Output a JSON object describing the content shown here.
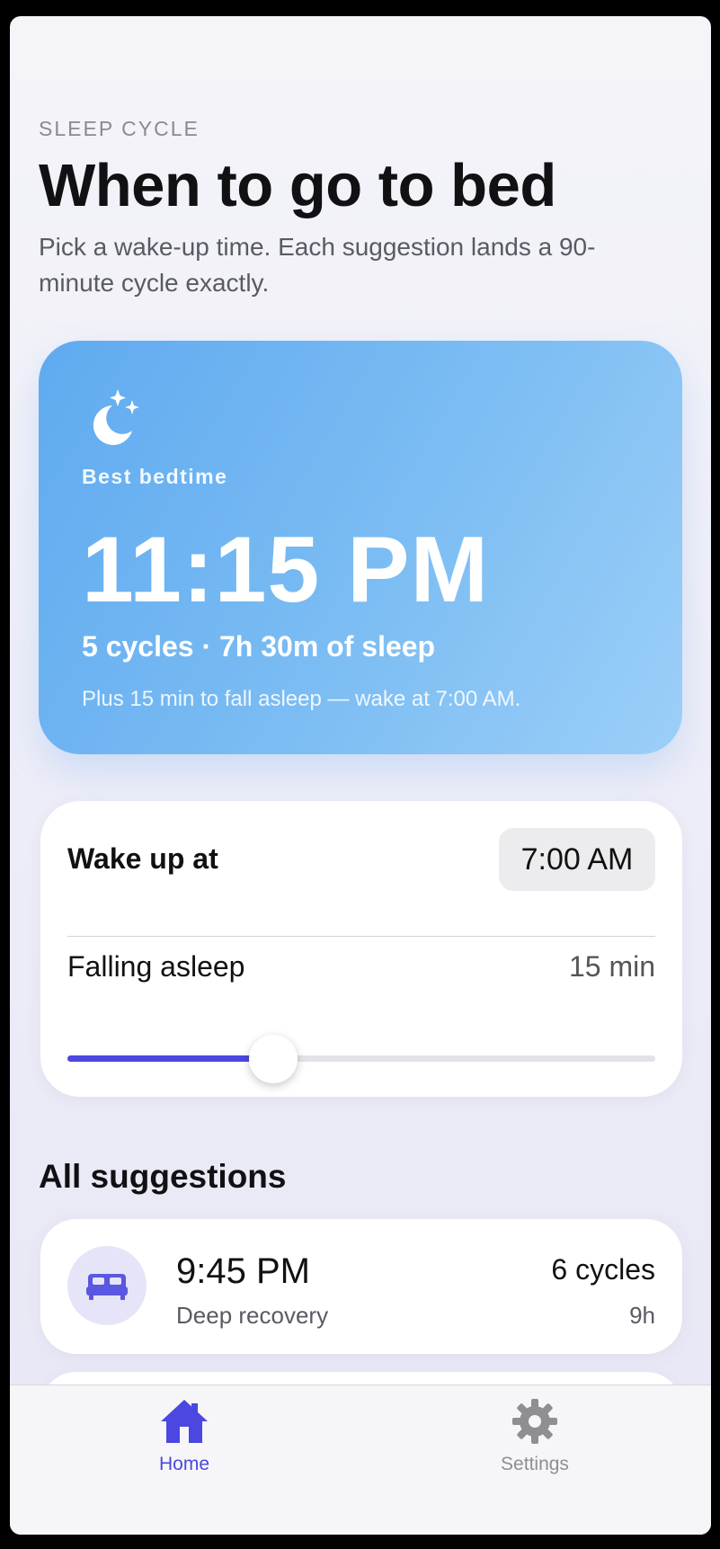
{
  "header": {
    "eyebrow": "SLEEP CYCLE",
    "title": "When to go to bed",
    "subtitle": "Pick a wake-up time. Each suggestion lands a 90-minute cycle exactly."
  },
  "hero": {
    "icon": "moon-stars-icon",
    "label": "Best bedtime",
    "time": "11:15 PM",
    "summary": "5 cycles · 7h 30m of sleep",
    "note": "Plus 15 min to fall asleep — wake at 7:00 AM."
  },
  "settings": {
    "wake_label": "Wake up at",
    "wake_time": "7:00 AM",
    "asleep_label": "Falling asleep",
    "asleep_value": "15 min",
    "slider_fraction": 0.35
  },
  "suggestions": {
    "title": "All suggestions",
    "items": [
      {
        "time": "9:45 PM",
        "description": "Deep recovery",
        "cycles": "6 cycles",
        "hours": "9h",
        "icon": "bed-icon"
      }
    ]
  },
  "tabbar": {
    "home": {
      "label": "Home",
      "icon": "home-icon"
    },
    "settings": {
      "label": "Settings",
      "icon": "gear-icon"
    }
  },
  "colors": {
    "accent": "#4b47e0",
    "hero_gradient_start": "#5faaf0",
    "hero_gradient_end": "#9ccff8",
    "inactive": "#8e8e93"
  }
}
